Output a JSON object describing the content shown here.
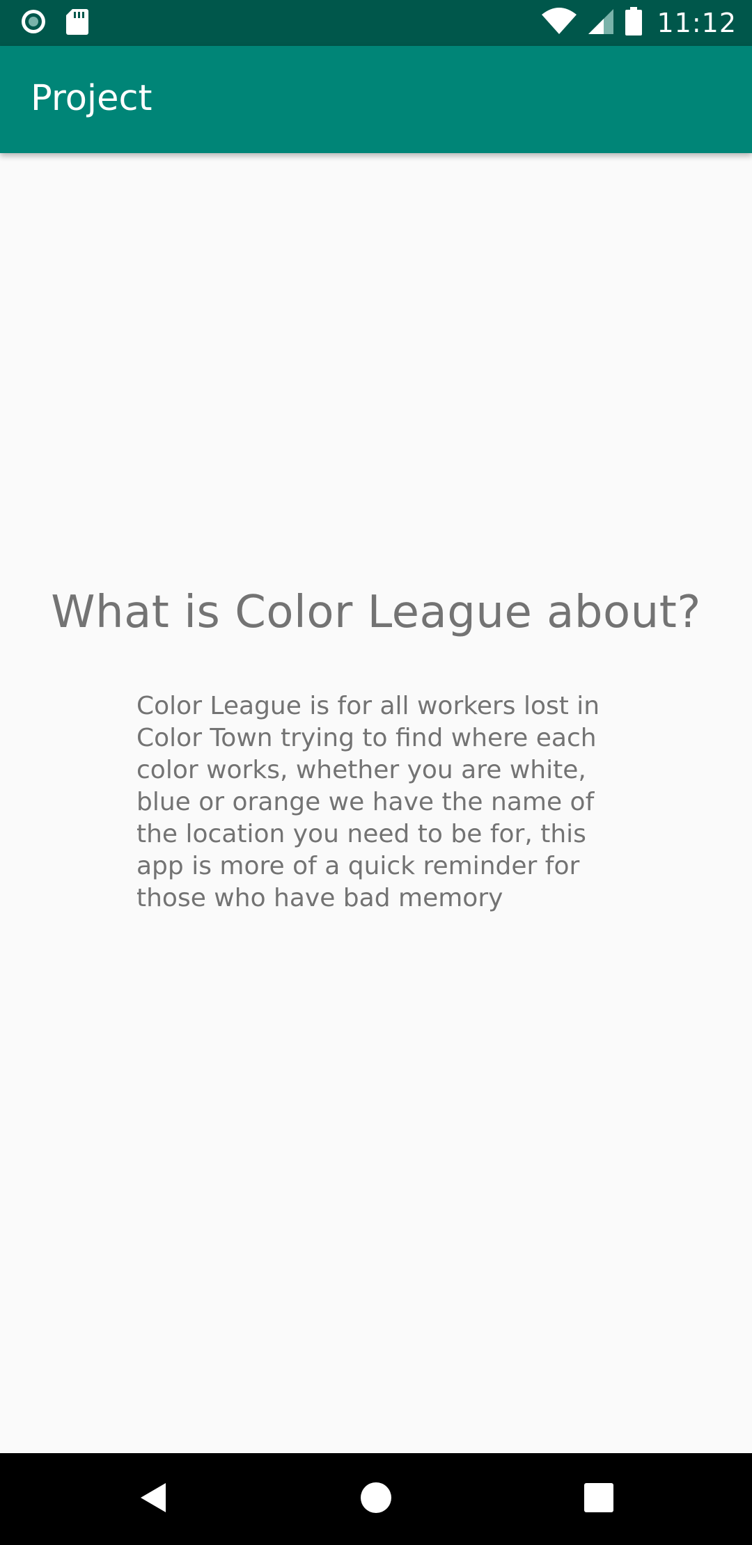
{
  "status_bar": {
    "time": "11:12",
    "icons": [
      "record-icon",
      "sd-card-icon",
      "wifi-icon",
      "signal-icon",
      "battery-icon"
    ],
    "background": "#00574b"
  },
  "app_bar": {
    "title": "Project",
    "background": "#008577"
  },
  "main": {
    "heading": "What is Color League about?",
    "description": "Color League is for all workers lost in Color Town trying to find where each color works, whether you are white, blue or orange we have the name of the location you need to be for, this app is more of a quick reminder for those who have bad memory"
  },
  "nav_bar": {
    "buttons": [
      "back-icon",
      "home-icon",
      "recents-icon"
    ],
    "background": "#000000"
  }
}
